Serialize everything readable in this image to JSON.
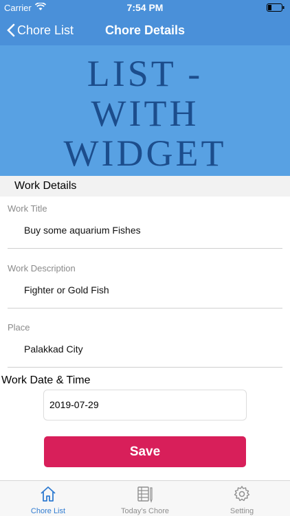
{
  "status_bar": {
    "carrier": "Carrier",
    "time": "7:54 PM"
  },
  "nav": {
    "back_label": "Chore List",
    "title": "Chore Details"
  },
  "banner": {
    "lines": [
      "LIST -",
      "WITH",
      "WIDGET"
    ]
  },
  "section": {
    "title": "Work Details"
  },
  "fields": {
    "title": {
      "label": "Work Title",
      "value": "Buy some aquarium Fishes"
    },
    "description": {
      "label": "Work Description",
      "value": "Fighter or Gold Fish"
    },
    "place": {
      "label": "Place",
      "value": "Palakkad City"
    }
  },
  "date": {
    "label": "Work Date & Time",
    "value": "2019-07-29"
  },
  "save_label": "Save",
  "tabs": [
    {
      "label": "Chore List",
      "icon": "home-icon",
      "active": true
    },
    {
      "label": "Today's Chore",
      "icon": "notebook-icon",
      "active": false
    },
    {
      "label": "Setting",
      "icon": "gear-icon",
      "active": false
    }
  ],
  "colors": {
    "nav": "#4a90d9",
    "banner": "#58a1e3",
    "banner_text": "#1c4d8c",
    "save": "#d81f5a",
    "tab_active": "#2f7bd1"
  }
}
